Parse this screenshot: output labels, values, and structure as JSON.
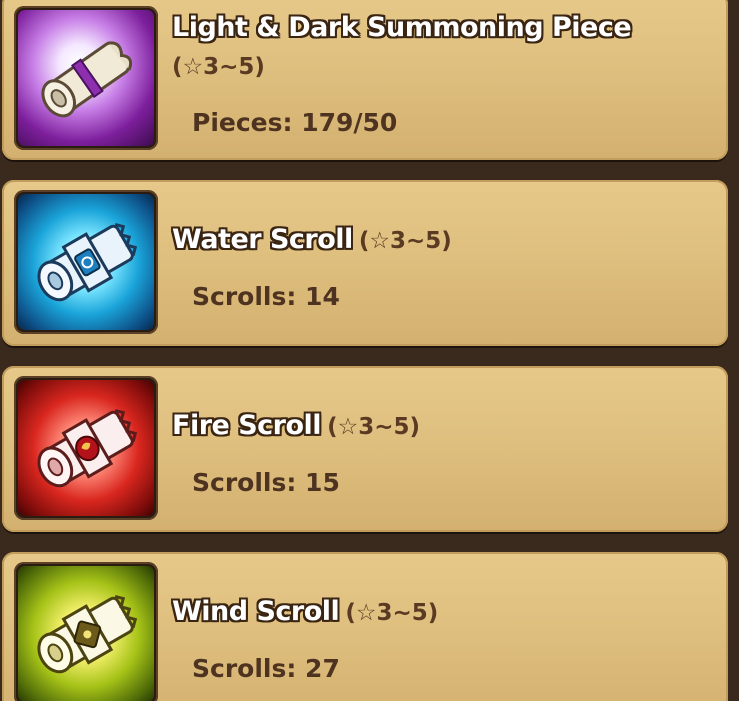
{
  "items": [
    {
      "name": "Light & Dark Summoning Piece",
      "grade": "(☆3~5)",
      "count_label": "Pieces: 179/50",
      "icon": "light-dark-piece-icon",
      "accent": "#8a2aa8"
    },
    {
      "name": "Water Scroll",
      "grade": "(☆3~5)",
      "count_label": "Scrolls: 14",
      "icon": "water-scroll-icon",
      "accent": "#1aa4d9"
    },
    {
      "name": "Fire Scroll",
      "grade": "(☆3~5)",
      "count_label": "Scrolls: 15",
      "icon": "fire-scroll-icon",
      "accent": "#d9271f"
    },
    {
      "name": "Wind Scroll",
      "grade": "(☆3~5)",
      "count_label": "Scrolls: 27",
      "icon": "wind-scroll-icon",
      "accent": "#a6c318"
    }
  ]
}
